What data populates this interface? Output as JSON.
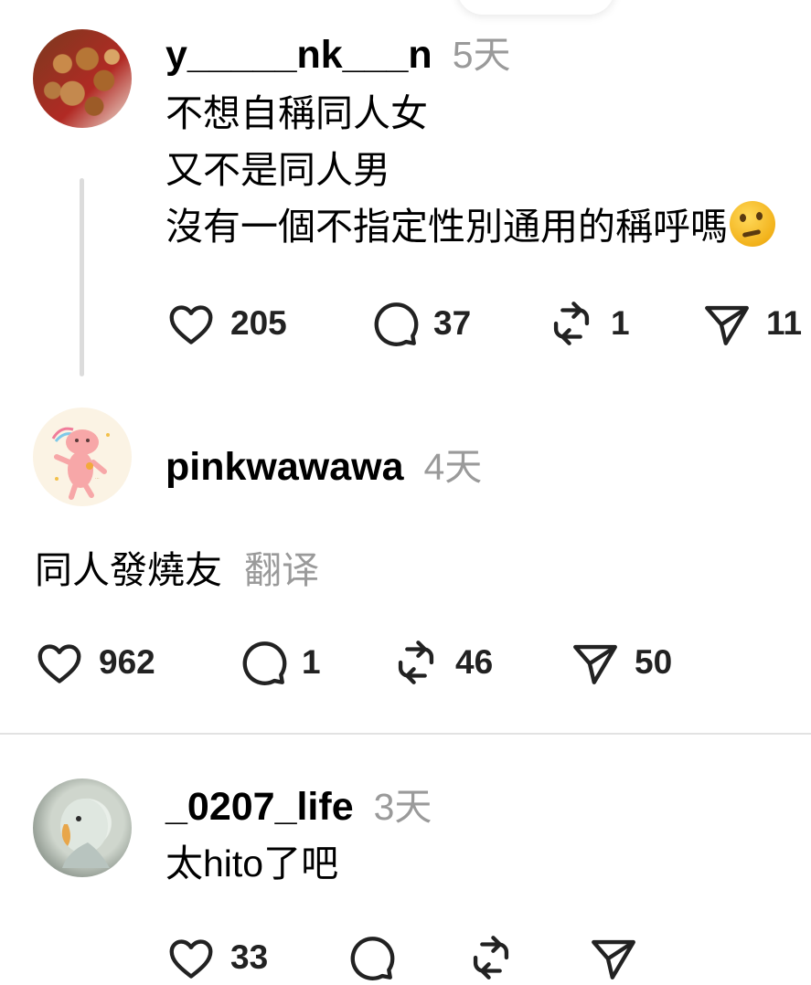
{
  "comments": [
    {
      "username": "y_____nk___n",
      "time": "5天",
      "lines": [
        "不想自稱同人女",
        "又不是同人男",
        "沒有一個不指定性別通用的稱呼嗎"
      ],
      "likes": "205",
      "replies": "37",
      "reposts": "1",
      "shares": "11"
    },
    {
      "username": "pinkwawawa",
      "time": "4天",
      "text": "同人發燒友",
      "translate": "翻译",
      "likes": "962",
      "replies": "1",
      "reposts": "46",
      "shares": "50"
    },
    {
      "username": "_0207_life",
      "time": "3天",
      "text": "太hito了吧",
      "likes": "33"
    }
  ],
  "icons": [
    "heart-icon",
    "comment-icon",
    "repost-icon",
    "share-icon",
    "thinking-face-emoji"
  ]
}
